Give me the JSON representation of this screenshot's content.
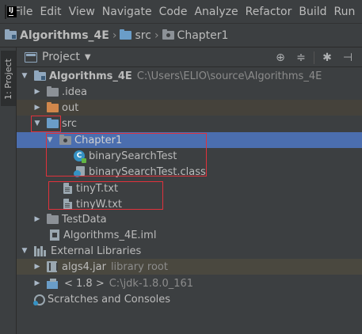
{
  "menu": [
    "File",
    "Edit",
    "View",
    "Navigate",
    "Code",
    "Analyze",
    "Refactor",
    "Build",
    "Run"
  ],
  "breadcrumb": [
    "Algorithms_4E",
    "src",
    "Chapter1"
  ],
  "toolstrip": {
    "tab_label": "1: Project"
  },
  "panel": {
    "title": "Project"
  },
  "tree": {
    "root": {
      "name": "Algorithms_4E",
      "path": "C:\\Users\\ELIO\\source\\Algorithms_4E"
    },
    "idea": ".idea",
    "out": "out",
    "src": "src",
    "chapter1": "Chapter1",
    "class_file": "binarySearchTest",
    "compiled_file": "binarySearchTest.class",
    "tinyT": "tinyT.txt",
    "tinyW": "tinyW.txt",
    "testdata": "TestData",
    "iml": "Algorithms_4E.iml",
    "ext_libs": "External Libraries",
    "algs4": {
      "name": "algs4.jar",
      "hint": "library root"
    },
    "jdk": {
      "name": "< 1.8 >",
      "hint": "C:\\jdk-1.8.0_161"
    },
    "scratches": "Scratches and Consoles"
  },
  "colors": {
    "background": "#3c3f41",
    "selection": "#4b6eaf",
    "annotation": "#e0323c",
    "folder_blue": "#6a9dc8",
    "folder_orange": "#d1874b"
  }
}
